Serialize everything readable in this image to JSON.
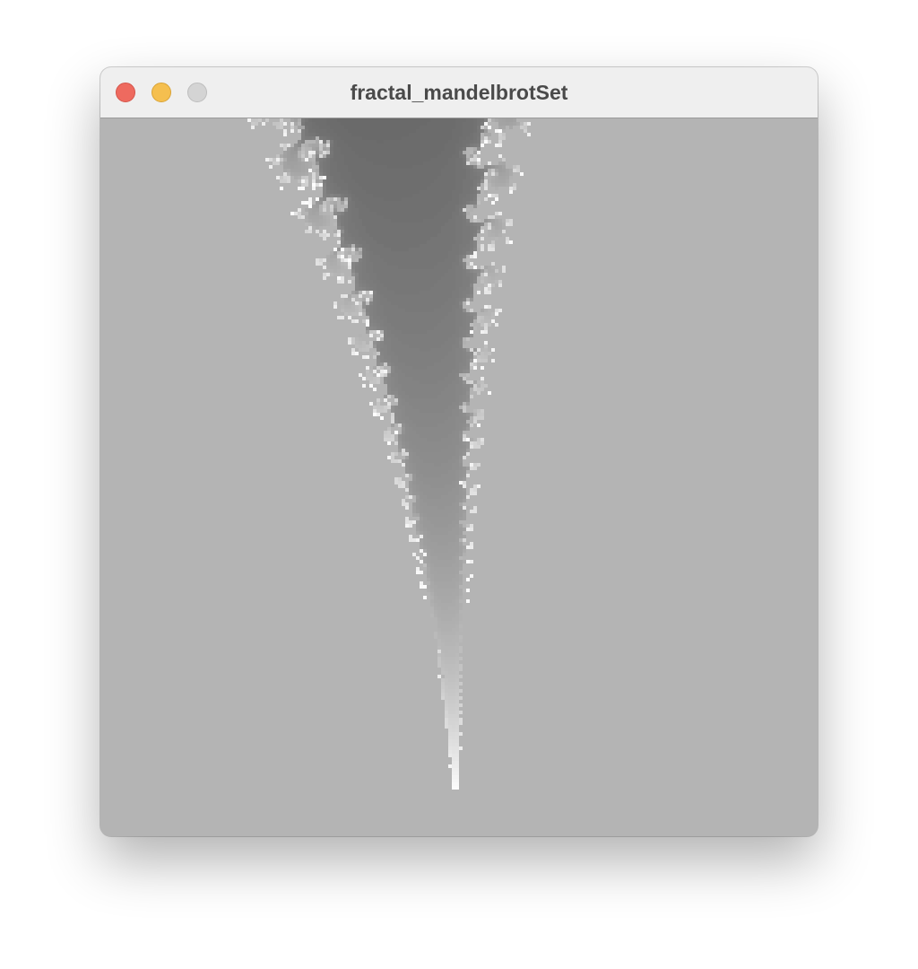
{
  "window": {
    "title": "fractal_mandelbrotSet",
    "controls": {
      "close_icon": "close-icon",
      "minimize_icon": "minimize-icon",
      "zoom_icon": "zoom-icon"
    },
    "colors": {
      "close": "#ee6a5f",
      "minimize": "#f5bf4f",
      "zoom": "#d4d4d4",
      "titlebar": "#efefef"
    }
  },
  "fractal": {
    "type": "mandelbrot",
    "set_color": "#b4b4b4",
    "background_color": "#0b0b0b",
    "palette": "grayscale"
  }
}
